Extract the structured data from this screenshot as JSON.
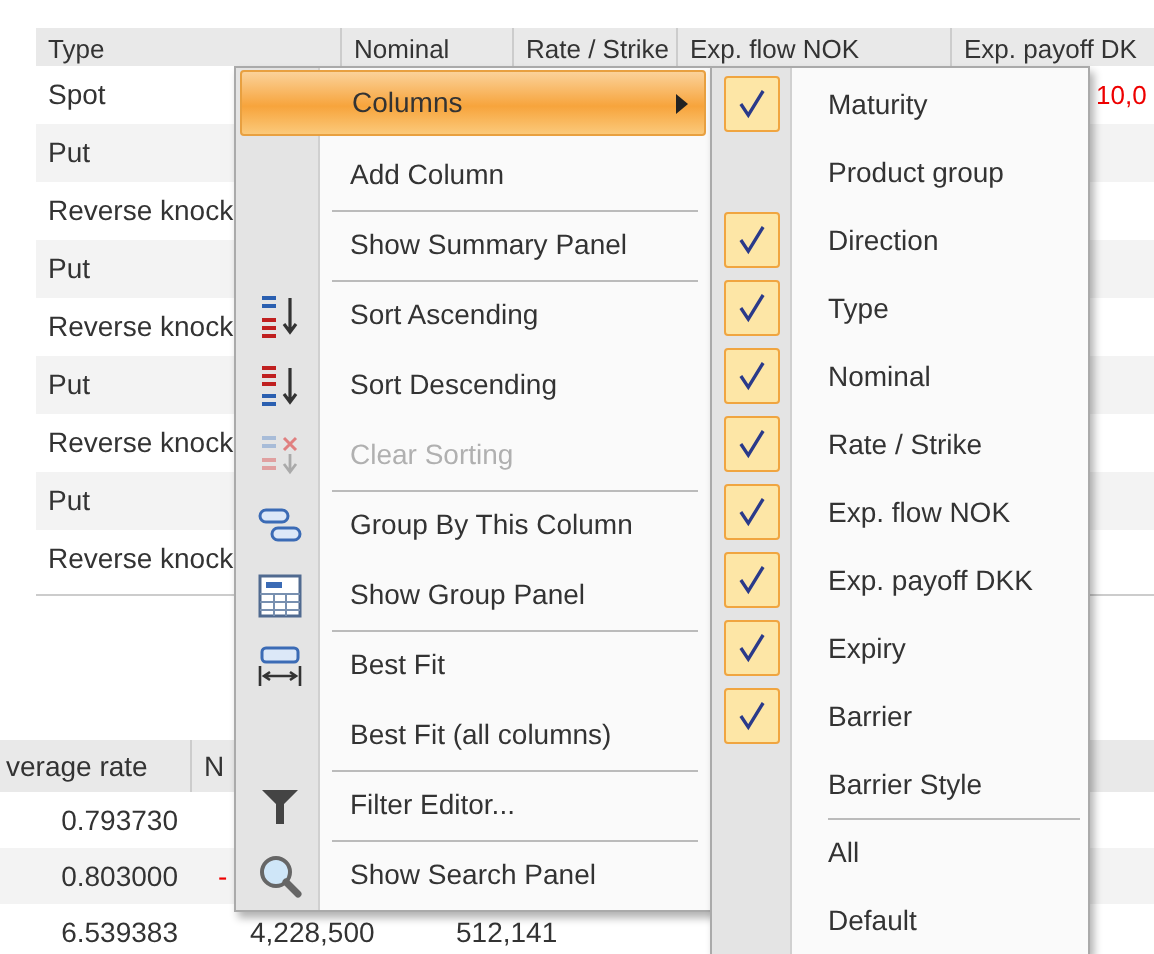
{
  "top_grid": {
    "columns": [
      "Type",
      "Nominal",
      "Rate / Strike",
      "Exp. flow NOK",
      "Exp. payoff DK"
    ],
    "rows": [
      {
        "cells": [
          "Spot",
          "",
          "",
          "",
          "10,0"
        ]
      },
      {
        "cells": [
          "Put",
          "",
          "",
          "",
          ""
        ]
      },
      {
        "cells": [
          "Reverse knock",
          "",
          "",
          "",
          ""
        ]
      },
      {
        "cells": [
          "Put",
          "",
          "",
          "",
          ""
        ]
      },
      {
        "cells": [
          "Reverse knock",
          "",
          "",
          "",
          ""
        ]
      },
      {
        "cells": [
          "Put",
          "",
          "",
          "",
          ""
        ]
      },
      {
        "cells": [
          "Reverse knock",
          "",
          "",
          "",
          ""
        ]
      },
      {
        "cells": [
          "Put",
          "",
          "",
          "",
          ""
        ]
      },
      {
        "cells": [
          "Reverse knock",
          "",
          "",
          "",
          ""
        ]
      }
    ]
  },
  "bottom_grid": {
    "columns": [
      "verage rate",
      "N"
    ],
    "rows": [
      {
        "cells": [
          "0.793730",
          "",
          "",
          ""
        ]
      },
      {
        "cells": [
          "0.803000",
          "-",
          "",
          ""
        ]
      },
      {
        "cells": [
          "6.539383",
          "",
          "4,228,500",
          "512,141"
        ]
      }
    ]
  },
  "context_menu": {
    "items": [
      {
        "label": "Columns",
        "highlighted": true,
        "submenu": true,
        "separator_before": false,
        "disabled": false
      },
      {
        "label": "Add Column",
        "highlighted": false,
        "submenu": false,
        "separator_before": false,
        "disabled": false
      },
      {
        "label": "Show Summary Panel",
        "highlighted": false,
        "submenu": false,
        "separator_before": true,
        "disabled": false
      },
      {
        "label": "Sort Ascending",
        "highlighted": false,
        "submenu": false,
        "separator_before": true,
        "disabled": false
      },
      {
        "label": "Sort Descending",
        "highlighted": false,
        "submenu": false,
        "separator_before": false,
        "disabled": false
      },
      {
        "label": "Clear Sorting",
        "highlighted": false,
        "submenu": false,
        "separator_before": false,
        "disabled": true
      },
      {
        "label": "Group By This Column",
        "highlighted": false,
        "submenu": false,
        "separator_before": true,
        "disabled": false
      },
      {
        "label": "Show Group Panel",
        "highlighted": false,
        "submenu": false,
        "separator_before": false,
        "disabled": false
      },
      {
        "label": "Best Fit",
        "highlighted": false,
        "submenu": false,
        "separator_before": true,
        "disabled": false
      },
      {
        "label": "Best Fit (all columns)",
        "highlighted": false,
        "submenu": false,
        "separator_before": false,
        "disabled": false
      },
      {
        "label": "Filter Editor...",
        "highlighted": false,
        "submenu": false,
        "separator_before": true,
        "disabled": false
      },
      {
        "label": "Show Search Panel",
        "highlighted": false,
        "submenu": false,
        "separator_before": true,
        "disabled": false
      }
    ]
  },
  "columns_submenu": {
    "items": [
      {
        "label": "Maturity",
        "checked": true,
        "separator_before": false
      },
      {
        "label": "Product group",
        "checked": false,
        "separator_before": false
      },
      {
        "label": "Direction",
        "checked": true,
        "separator_before": false
      },
      {
        "label": "Type",
        "checked": true,
        "separator_before": false
      },
      {
        "label": "Nominal",
        "checked": true,
        "separator_before": false
      },
      {
        "label": "Rate / Strike",
        "checked": true,
        "separator_before": false
      },
      {
        "label": "Exp. flow NOK",
        "checked": true,
        "separator_before": false
      },
      {
        "label": "Exp. payoff DKK",
        "checked": true,
        "separator_before": false
      },
      {
        "label": "Expiry",
        "checked": true,
        "separator_before": false
      },
      {
        "label": "Barrier",
        "checked": true,
        "separator_before": false
      },
      {
        "label": "Barrier Style",
        "checked": false,
        "separator_before": false
      },
      {
        "label": "All",
        "checked": false,
        "separator_before": true
      },
      {
        "label": "Default",
        "checked": false,
        "separator_before": false
      }
    ]
  }
}
